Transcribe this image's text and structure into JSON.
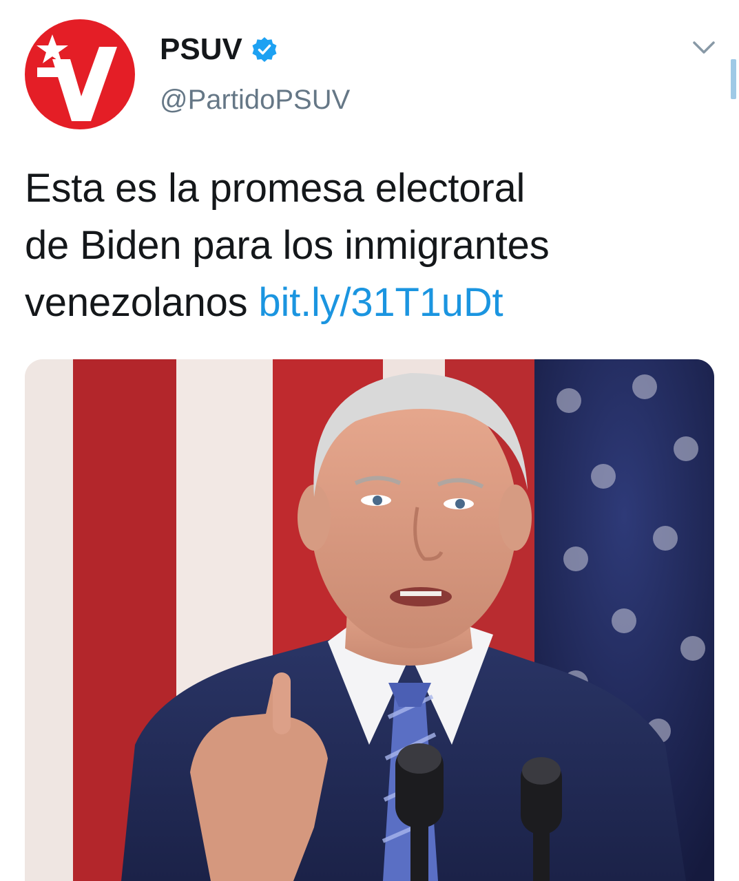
{
  "tweet": {
    "author": {
      "display_name": "PSUV",
      "handle": "@PartidoPSUV",
      "verified": true,
      "avatar_icon": "psuv-logo-icon",
      "brand_color": "#e41e26"
    },
    "menu_icon": "chevron-down-icon",
    "text": {
      "line1": "Esta es la promesa electoral",
      "line2": "de Biden para los inmigrantes",
      "line3": "venezolanos",
      "link": "bit.ly/31T1uDt"
    },
    "media": {
      "type": "photo"
    },
    "colors": {
      "link": "#1b95e0",
      "verified": "#1da1f2",
      "text": "#14171a",
      "secondary": "#657786"
    }
  }
}
